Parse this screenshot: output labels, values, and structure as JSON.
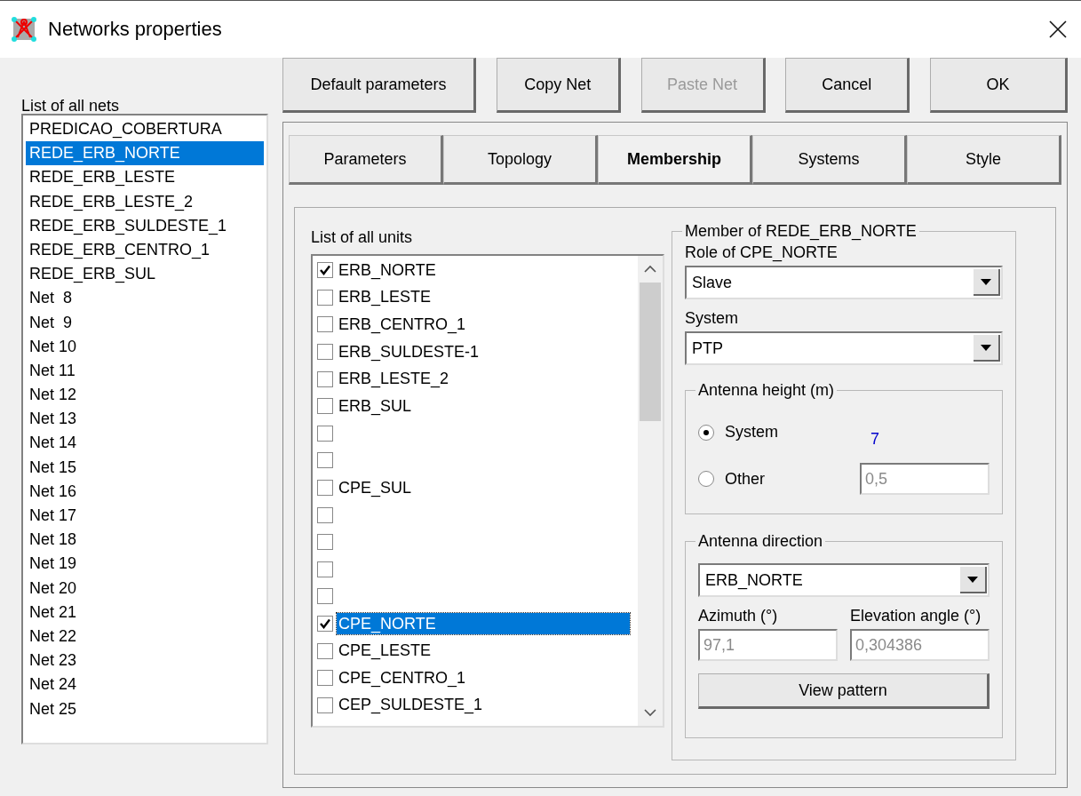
{
  "window": {
    "title": "Networks properties"
  },
  "toolbar": [
    {
      "label": "Default parameters",
      "disabled": false
    },
    {
      "label": "Copy Net",
      "disabled": false
    },
    {
      "label": "Paste Net",
      "disabled": true
    },
    {
      "label": "Cancel",
      "disabled": false
    },
    {
      "label": "OK",
      "disabled": false
    }
  ],
  "nets": {
    "label": "List of all nets",
    "items": [
      {
        "label": "PREDICAO_COBERTURA",
        "selected": false
      },
      {
        "label": "REDE_ERB_NORTE",
        "selected": true
      },
      {
        "label": "REDE_ERB_LESTE",
        "selected": false
      },
      {
        "label": "REDE_ERB_LESTE_2",
        "selected": false
      },
      {
        "label": "REDE_ERB_SULDESTE_1",
        "selected": false
      },
      {
        "label": "REDE_ERB_CENTRO_1",
        "selected": false
      },
      {
        "label": "REDE_ERB_SUL",
        "selected": false
      },
      {
        "label": "Net  8",
        "selected": false
      },
      {
        "label": "Net  9",
        "selected": false
      },
      {
        "label": "Net 10",
        "selected": false
      },
      {
        "label": "Net 11",
        "selected": false
      },
      {
        "label": "Net 12",
        "selected": false
      },
      {
        "label": "Net 13",
        "selected": false
      },
      {
        "label": "Net 14",
        "selected": false
      },
      {
        "label": "Net 15",
        "selected": false
      },
      {
        "label": "Net 16",
        "selected": false
      },
      {
        "label": "Net 17",
        "selected": false
      },
      {
        "label": "Net 18",
        "selected": false
      },
      {
        "label": "Net 19",
        "selected": false
      },
      {
        "label": "Net 20",
        "selected": false
      },
      {
        "label": "Net 21",
        "selected": false
      },
      {
        "label": "Net 22",
        "selected": false
      },
      {
        "label": "Net 23",
        "selected": false
      },
      {
        "label": "Net 24",
        "selected": false
      },
      {
        "label": "Net 25",
        "selected": false
      }
    ]
  },
  "tabs": [
    {
      "label": "Parameters",
      "selected": false
    },
    {
      "label": "Topology",
      "selected": false
    },
    {
      "label": "Membership",
      "selected": true
    },
    {
      "label": "Systems",
      "selected": false
    },
    {
      "label": "Style",
      "selected": false
    }
  ],
  "units": {
    "label": "List of all units",
    "items": [
      {
        "label": "ERB_NORTE",
        "checked": true,
        "selected": false
      },
      {
        "label": "ERB_LESTE",
        "checked": false,
        "selected": false
      },
      {
        "label": "ERB_CENTRO_1",
        "checked": false,
        "selected": false
      },
      {
        "label": "ERB_SULDESTE-1",
        "checked": false,
        "selected": false
      },
      {
        "label": "ERB_LESTE_2",
        "checked": false,
        "selected": false
      },
      {
        "label": "ERB_SUL",
        "checked": false,
        "selected": false
      },
      {
        "checked": false,
        "selected": false
      },
      {
        "checked": false,
        "selected": false
      },
      {
        "label": "CPE_SUL",
        "checked": false,
        "selected": false
      },
      {
        "checked": false,
        "selected": false
      },
      {
        "checked": false,
        "selected": false
      },
      {
        "checked": false,
        "selected": false
      },
      {
        "checked": false,
        "selected": false
      },
      {
        "label": "CPE_NORTE",
        "checked": true,
        "selected": true
      },
      {
        "label": "CPE_LESTE",
        "checked": false,
        "selected": false
      },
      {
        "label": "CPE_CENTRO_1",
        "checked": false,
        "selected": false
      },
      {
        "label": "CEP_SULDESTE_1",
        "checked": false,
        "selected": false
      }
    ]
  },
  "member": {
    "title": "Member of REDE_ERB_NORTE",
    "role_label": "Role of CPE_NORTE",
    "role_value": "Slave",
    "system_label": "System",
    "system_value": "PTP",
    "height": {
      "title": "Antenna height (m)",
      "options": [
        {
          "label": "System",
          "selected": true
        },
        {
          "label": "Other",
          "selected": false
        }
      ],
      "system_value": "7",
      "other_value": "0,5",
      "other_disabled": true
    },
    "direction": {
      "title": "Antenna direction",
      "value": "ERB_NORTE",
      "azimuth_label": "Azimuth (°)",
      "azimuth_value": "97,1",
      "elevation_label": "Elevation angle (°)",
      "elevation_value": "0,304386",
      "values_disabled": true,
      "button": "View pattern"
    }
  }
}
